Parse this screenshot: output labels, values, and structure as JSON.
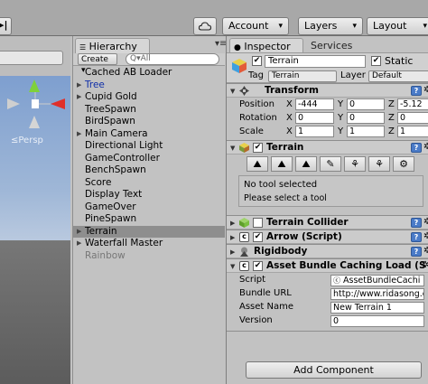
{
  "toolbar": {
    "step_label": "▸|",
    "cloud_icon": "cloud-icon",
    "account_label": "Account",
    "layers_label": "Layers",
    "layout_label": "Layout"
  },
  "scene": {
    "persp_label": "≤Persp"
  },
  "hierarchy": {
    "tab_label": "Hierarchy",
    "create_label": "Create ▾",
    "search_placeholder": "Q▾All",
    "items": [
      {
        "label": "Cached AB Loader",
        "expand": false,
        "style": ""
      },
      {
        "label": "Tree",
        "expand": true,
        "style": "blue"
      },
      {
        "label": "Cupid Gold",
        "expand": true,
        "style": ""
      },
      {
        "label": "TreeSpawn",
        "expand": false,
        "style": ""
      },
      {
        "label": "BirdSpawn",
        "expand": false,
        "style": ""
      },
      {
        "label": "Main Camera",
        "expand": true,
        "style": ""
      },
      {
        "label": "Directional Light",
        "expand": false,
        "style": ""
      },
      {
        "label": "GameController",
        "expand": false,
        "style": ""
      },
      {
        "label": "BenchSpawn",
        "expand": false,
        "style": ""
      },
      {
        "label": "Score",
        "expand": false,
        "style": ""
      },
      {
        "label": "Display Text",
        "expand": false,
        "style": ""
      },
      {
        "label": "GameOver",
        "expand": false,
        "style": ""
      },
      {
        "label": "PineSpawn",
        "expand": false,
        "style": ""
      },
      {
        "label": "Terrain",
        "expand": true,
        "style": "sel"
      },
      {
        "label": "Waterfall Master",
        "expand": true,
        "style": ""
      },
      {
        "label": "Rainbow",
        "expand": false,
        "style": "gray"
      }
    ]
  },
  "inspector": {
    "tab_label": "Inspector",
    "services_label": "Services",
    "object_name": "Terrain",
    "static_label": "Static",
    "tag_label": "Tag",
    "tag_value": "Terrain",
    "layer_label": "Layer",
    "layer_value": "Default",
    "transform": {
      "title": "Transform",
      "position_label": "Position",
      "rotation_label": "Rotation",
      "scale_label": "Scale",
      "axis_x": "X",
      "axis_y": "Y",
      "axis_z": "Z",
      "position": [
        "-444",
        "0",
        "-5.12"
      ],
      "rotation": [
        "0",
        "0",
        "0"
      ],
      "scale": [
        "1",
        "1",
        "1"
      ]
    },
    "terrain": {
      "title": "Terrain",
      "tools": [
        "⛰",
        "⛰",
        "⛰",
        "✎",
        "⚘",
        "⚘",
        "⚙"
      ],
      "no_tool": "No tool selected",
      "select_tool": "Please select a tool"
    },
    "terrain_collider": {
      "title": "Terrain Collider"
    },
    "arrow_script": {
      "title": "Arrow (Script)"
    },
    "rigidbody": {
      "title": "Rigidbody"
    },
    "asset_bundle": {
      "title": "Asset Bundle Caching Load (S",
      "script_label": "Script",
      "script_value": "AssetBundleCachi",
      "bundle_url_label": "Bundle URL",
      "bundle_url_value": "http://www.ridasong.c",
      "asset_name_label": "Asset Name",
      "asset_name_value": "New Terrain 1",
      "version_label": "Version",
      "version_value": "0"
    },
    "add_component_label": "Add Component"
  },
  "colors": {
    "panel_bg": "#c2c2c2",
    "selection": "#8e8e8e",
    "link_blue": "#0f2ea8",
    "help_blue": "#4a7bc8"
  }
}
